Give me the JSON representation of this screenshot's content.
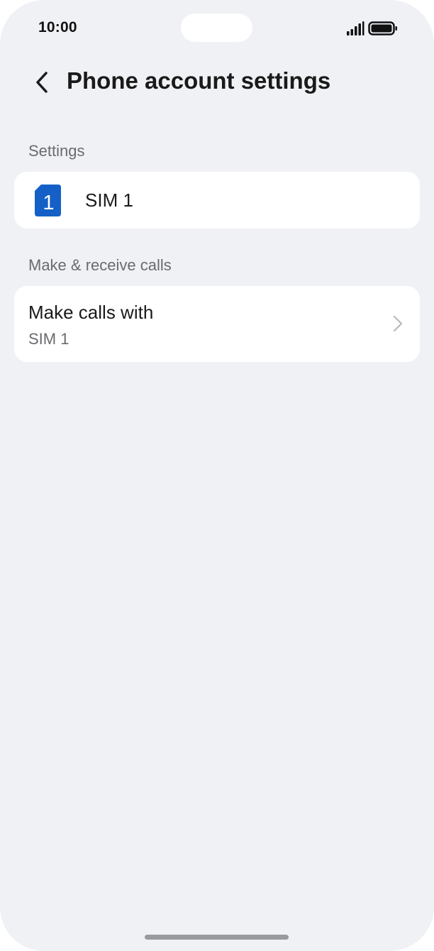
{
  "status_bar": {
    "time": "10:00",
    "signal_icon": "signal-bars-icon",
    "battery_icon": "battery-full-icon"
  },
  "header": {
    "back_icon": "chevron-left-icon",
    "title": "Phone account settings"
  },
  "settings_section": {
    "label": "Settings",
    "sim_item": {
      "icon": "sim-1-icon",
      "icon_text": "1",
      "label": "SIM 1"
    }
  },
  "calls_section": {
    "label": "Make & receive calls",
    "make_calls_item": {
      "title": "Make calls with",
      "value": "SIM 1",
      "chevron_icon": "chevron-right-icon"
    }
  },
  "colors": {
    "background": "#f0f1f5",
    "card": "#ffffff",
    "sim_blue": "#1460c7",
    "secondary_text": "#6a6a6f"
  }
}
